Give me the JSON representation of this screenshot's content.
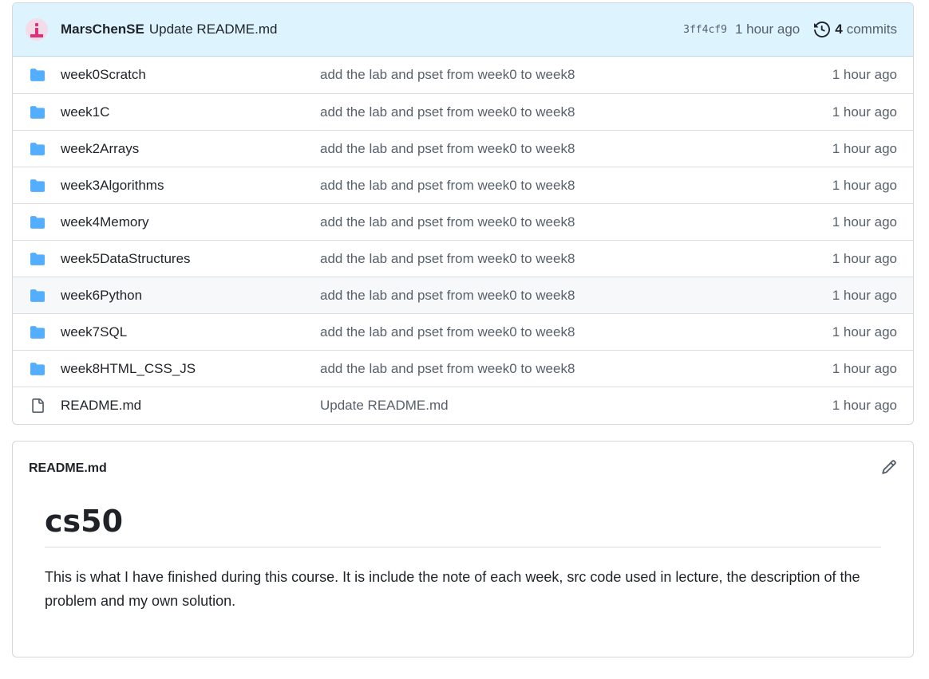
{
  "commit": {
    "author": "MarsChenSE",
    "message": "Update README.md",
    "sha": "3ff4cf9",
    "time": "1 hour ago",
    "count": "4",
    "count_label": "commits"
  },
  "files": [
    {
      "type": "folder",
      "name": "week0Scratch",
      "message": "add the lab and pset from week0 to week8",
      "time": "1 hour ago"
    },
    {
      "type": "folder",
      "name": "week1C",
      "message": "add the lab and pset from week0 to week8",
      "time": "1 hour ago"
    },
    {
      "type": "folder",
      "name": "week2Arrays",
      "message": "add the lab and pset from week0 to week8",
      "time": "1 hour ago"
    },
    {
      "type": "folder",
      "name": "week3Algorithms",
      "message": "add the lab and pset from week0 to week8",
      "time": "1 hour ago"
    },
    {
      "type": "folder",
      "name": "week4Memory",
      "message": "add the lab and pset from week0 to week8",
      "time": "1 hour ago"
    },
    {
      "type": "folder",
      "name": "week5DataStructures",
      "message": "add the lab and pset from week0 to week8",
      "time": "1 hour ago"
    },
    {
      "type": "folder",
      "name": "week6Python",
      "message": "add the lab and pset from week0 to week8",
      "time": "1 hour ago"
    },
    {
      "type": "folder",
      "name": "week7SQL",
      "message": "add the lab and pset from week0 to week8",
      "time": "1 hour ago"
    },
    {
      "type": "folder",
      "name": "week8HTML_CSS_JS",
      "message": "add the lab and pset from week0 to week8",
      "time": "1 hour ago"
    },
    {
      "type": "file",
      "name": "README.md",
      "message": "Update README.md",
      "time": "1 hour ago"
    }
  ],
  "readme": {
    "filename": "README.md",
    "heading": "cs50",
    "body": "This is what I have finished during this course. It is include the note of each week, src code used in lecture, the description of the problem and my own solution."
  },
  "icons": {
    "folder": "folder-icon",
    "file": "file-icon",
    "history": "history-icon",
    "edit": "pencil-icon"
  },
  "colors": {
    "folder": "#54aeff",
    "commit_bar": "#ddf4ff",
    "muted": "#57606a"
  }
}
